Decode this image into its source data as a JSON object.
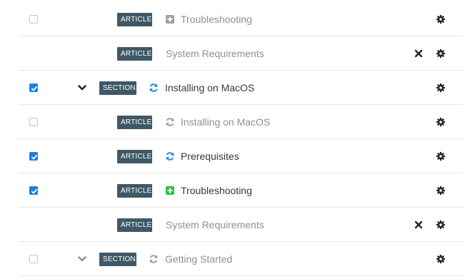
{
  "rows": [
    {
      "checkbox": "unchecked",
      "badge": "ARTICLE",
      "status_icon": "plus-square-icon",
      "title": "Troubleshooting",
      "title_style": "muted",
      "removable": false
    },
    {
      "checkbox": "none",
      "badge": "ARTICLE",
      "status_icon": "",
      "title": "System Requirements",
      "title_style": "muted",
      "removable": true
    },
    {
      "checkbox": "checked",
      "expand": "chevron-down-icon",
      "badge": "SECTION",
      "status_icon": "sync-icon",
      "title": "Installing on MacOS",
      "title_style": "dark",
      "removable": false
    },
    {
      "checkbox": "unchecked",
      "badge": "ARTICLE",
      "status_icon": "sync-icon",
      "title": "Installing on MacOS",
      "title_style": "muted",
      "removable": false
    },
    {
      "checkbox": "checked",
      "badge": "ARTICLE",
      "status_icon": "sync-icon",
      "title": "Prerequisites",
      "title_style": "dark",
      "removable": false
    },
    {
      "checkbox": "checked",
      "badge": "ARTICLE",
      "status_icon": "plus-square-icon",
      "title": "Troubleshooting",
      "title_style": "dark",
      "removable": false
    },
    {
      "checkbox": "none",
      "badge": "ARTICLE",
      "status_icon": "",
      "title": "System Requirements",
      "title_style": "muted",
      "removable": true
    },
    {
      "checkbox": "unchecked",
      "expand": "chevron-down-icon",
      "badge": "SECTION",
      "status_icon": "sync-icon",
      "title": "Getting Started",
      "title_style": "muted",
      "removable": false
    }
  ],
  "colors": {
    "badge_bg": "#3f5866",
    "checkbox_checked": "#1a82e2",
    "sync_active": "#1f8ae6",
    "sync_inactive": "#9aa0a6",
    "plus_active": "#2fbf4a",
    "plus_inactive": "#9aa0a6",
    "text_dark": "#333a40",
    "text_muted": "#8a9096",
    "divider": "#e3e6e9"
  }
}
